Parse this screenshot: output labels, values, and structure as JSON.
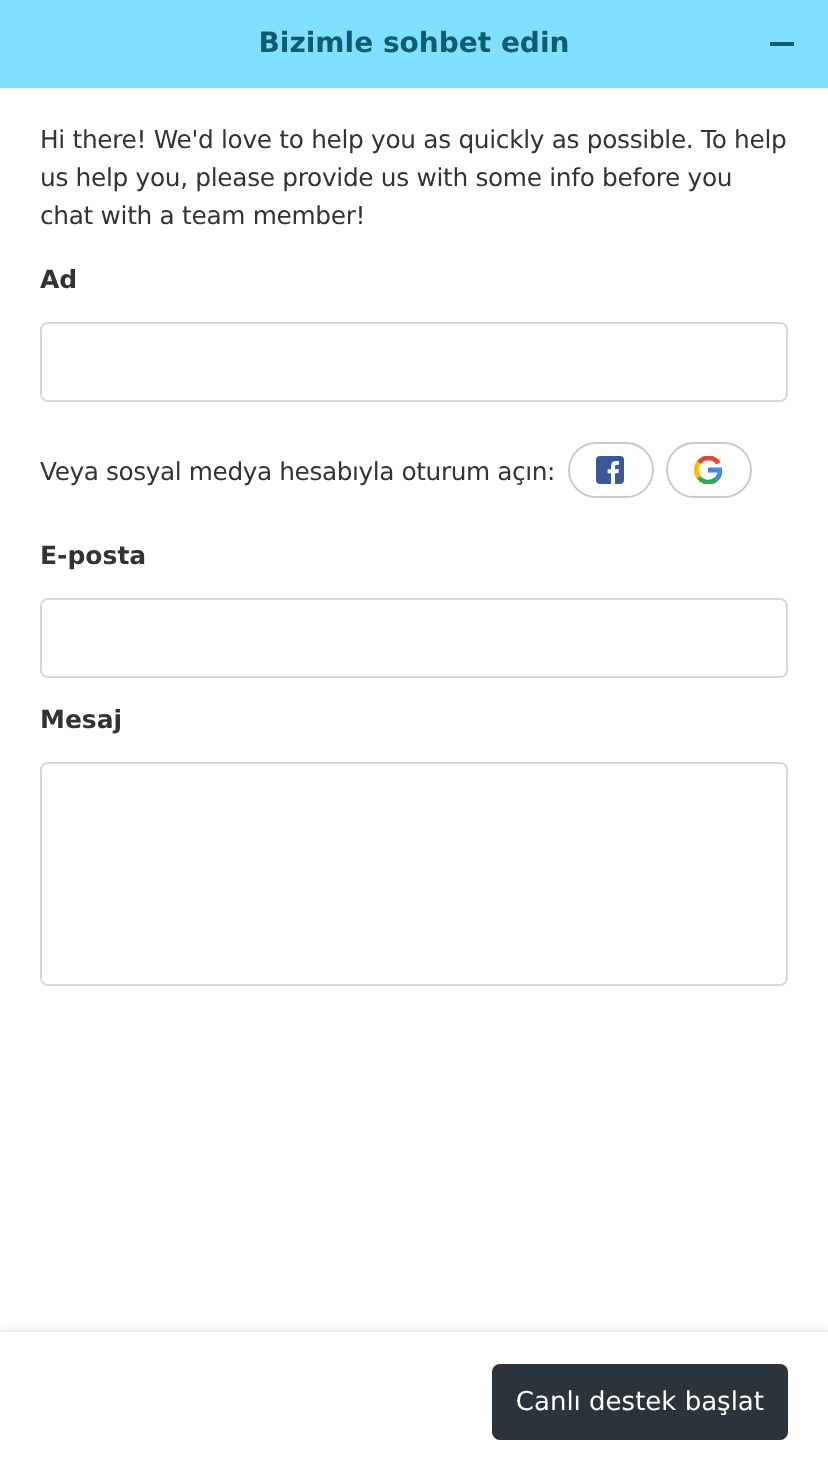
{
  "header": {
    "title": "Bizimle sohbet edin"
  },
  "intro": "Hi there! We'd love to help you as quickly as possible. To help us help you, please provide us with some info before you chat with a team member!",
  "fields": [
    {
      "kind": "input",
      "label": "Ad"
    },
    {
      "kind": "social",
      "label": "Veya sosyal medya hesabıyla oturum açın:"
    },
    {
      "kind": "input",
      "label": "E-posta"
    },
    {
      "kind": "textarea",
      "label": "Mesaj"
    }
  ],
  "footer": {
    "button": "Canlı destek başlat"
  }
}
